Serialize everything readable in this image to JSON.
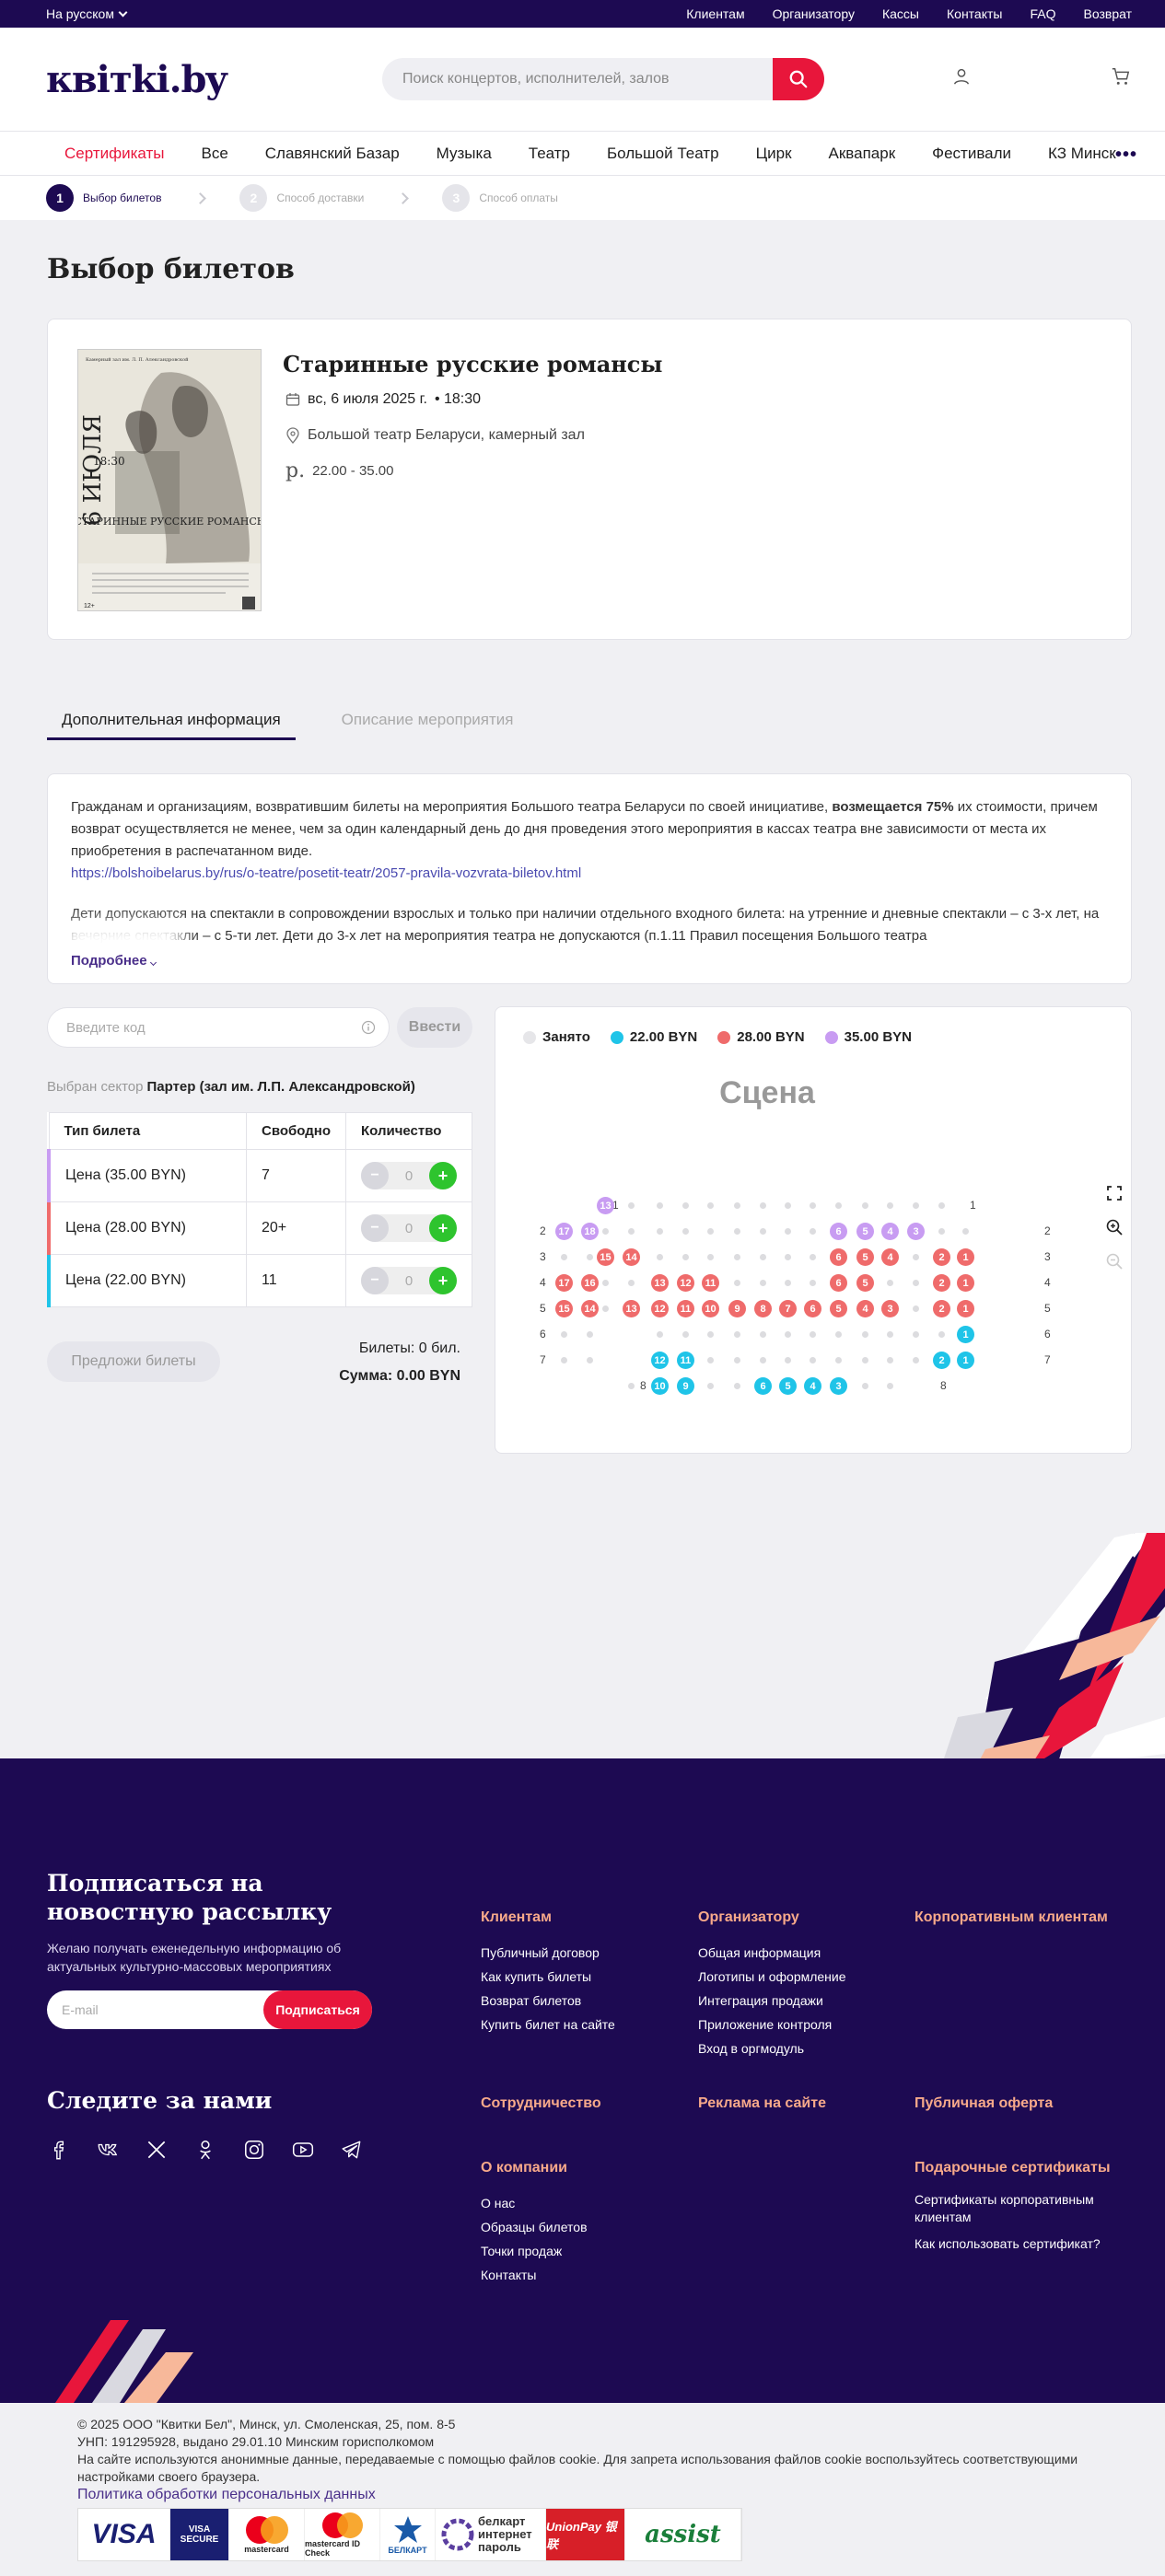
{
  "topbar": {
    "lang": "На русском",
    "links": [
      "Клиентам",
      "Организатору",
      "Кассы",
      "Контакты",
      "FAQ",
      "Возврат"
    ]
  },
  "header": {
    "logo": "квiтki.by",
    "search_placeholder": "Поиск концертов, исполнителей, залов"
  },
  "nav": {
    "items": [
      "Сертификаты",
      "Все",
      "Славянский Базар",
      "Музыка",
      "Театр",
      "Большой Театр",
      "Цирк",
      "Аквапарк",
      "Фестивали",
      "КЗ Минск"
    ],
    "more": "•••"
  },
  "steps": [
    {
      "num": "1",
      "label": "Выбор билетов"
    },
    {
      "num": "2",
      "label": "Способ доставки"
    },
    {
      "num": "3",
      "label": "Способ оплаты"
    }
  ],
  "page_title": "Выбор билетов",
  "event": {
    "title": "Старинные русские романсы",
    "date": "вс, 6 июля 2025 г.",
    "time": "• 18:30",
    "place": "Большой театр Беларуси, камерный зал",
    "currency": "р.",
    "price": "22.00 - 35.00",
    "poster": {
      "top": "Камерный зал им. Л. П. Александровской",
      "date": "6 ИЮЛЯ",
      "time": "18:30",
      "title": "СТАРИННЫЕ РУССКИЕ РОМАНСЫ",
      "age": "12+"
    }
  },
  "tabs": [
    "Дополнительная информация",
    "Описание мероприятия"
  ],
  "info": {
    "p1_a": "Гражданам и организациям, возвратившим билеты на мероприятия Большого театра Беларуси по своей инициативе, ",
    "p1_b": "возмещается 75%",
    "p1_c": " их стоимости, причем возврат осуществляется не менее, чем за один календарный день до дня проведения этого мероприятия в кассах театра вне зависимости от места их приобретения в распечатанном виде.",
    "link": "https://bolshoibelarus.by/rus/o-teatre/posetit-teatr/2057-pravila-vozvrata-biletov.html",
    "p2": "Дети допускаются на спектакли в сопровождении взрослых и только при наличии отдельного входного билета: на утренние и дневные спектакли – с 3-х лет, на вечерние спектакли – с 5-ти лет. Дети до 3-х лет на мероприятия театра не допускаются (п.1.11 Правил посещения Большого театра",
    "more": "Подробнее"
  },
  "promo": {
    "placeholder": "Введите код",
    "button": "Ввести"
  },
  "sector": {
    "label": "Выбран сектор",
    "value": "Партер (зал им. Л.П. Александровской)"
  },
  "tickets": {
    "headers": [
      "Тип билета",
      "Свободно",
      "Количество"
    ],
    "rows": [
      {
        "type": "Цена (35.00 BYN)",
        "free": "7",
        "qty": "0",
        "color": "#c89cf2"
      },
      {
        "type": "Цена (28.00 BYN)",
        "free": "20+",
        "qty": "0",
        "color": "#ef6b6b"
      },
      {
        "type": "Цена (22.00 BYN)",
        "free": "11",
        "qty": "0",
        "color": "#1fc4e8"
      }
    ]
  },
  "offer_button": "Предложи билеты",
  "summary": {
    "tickets": "Билеты: 0 бил.",
    "sum": "Сумма: 0.00 BYN"
  },
  "legend": [
    {
      "label": "Занято",
      "color": "#e6e6e9"
    },
    {
      "label": "22.00 BYN",
      "color": "#1fc4e8"
    },
    {
      "label": "28.00 BYN",
      "color": "#ef6b6b"
    },
    {
      "label": "35.00 BYN",
      "color": "#c89cf2"
    }
  ],
  "stage": "Сцена",
  "footer": {
    "newsletter_title": "Подписаться на новостную рассылку",
    "newsletter_desc": "Желаю получать еженедельную информацию об актуальных культурно-массовых мероприятиях",
    "email_placeholder": "E-mail",
    "subscribe": "Подписаться",
    "follow": "Следите за нами",
    "social": [
      "facebook-icon",
      "vk-icon",
      "x-icon",
      "ok-icon",
      "instagram-icon",
      "youtube-icon",
      "telegram-icon"
    ],
    "col1": {
      "title": "Клиентам",
      "links": [
        "Публичный договор",
        "Как купить билеты",
        "Возврат билетов",
        "Купить билет на сайте"
      ]
    },
    "col2": {
      "title": "Организатору",
      "links": [
        "Общая информация",
        "Логотипы и оформление",
        "Интеграция продажи",
        "Приложение контроля",
        "Вход в оргмодуль"
      ]
    },
    "col3": {
      "title": "Корпоративным клиентам"
    },
    "coop": "Сотрудничество",
    "ads": "Реклама на сайте",
    "offer": "Публичная оферта",
    "about": {
      "title": "О компании",
      "links": [
        "О нас",
        "Образцы билетов",
        "Точки продаж",
        "Контакты"
      ]
    },
    "gift": {
      "title": "Подарочные сертификаты",
      "links": [
        "Сертификаты корпоративным клиентам",
        "Как использовать сертификат?"
      ]
    }
  },
  "legal": {
    "l1": "© 2025 ООО \"Квитки Бел\", Минск, ул. Смоленская, 25, пом. 8-5",
    "l2": "УНП: 191295928, выдано 29.01.10 Минским горисполкомом",
    "l3": "На сайте используются анонимные данные, передаваемые с помощью файлов cookie. Для запрета использования файлов cookie воспользуйтесь соответствующими настройками своего браузера.",
    "link": "Политика обработки персональных данных"
  },
  "payments": [
    "VISA",
    "VISA SECURE",
    "mastercard",
    "mastercard ID Check",
    "БЕЛКАРТ",
    "белкарт интернет пароль",
    "UnionPay 银联",
    "assist"
  ],
  "colors": {
    "brand": "#1d0a52",
    "accent": "#e8163b",
    "c35": "#c89cf2",
    "c28": "#ef6b6b",
    "c22": "#1fc4e8"
  }
}
